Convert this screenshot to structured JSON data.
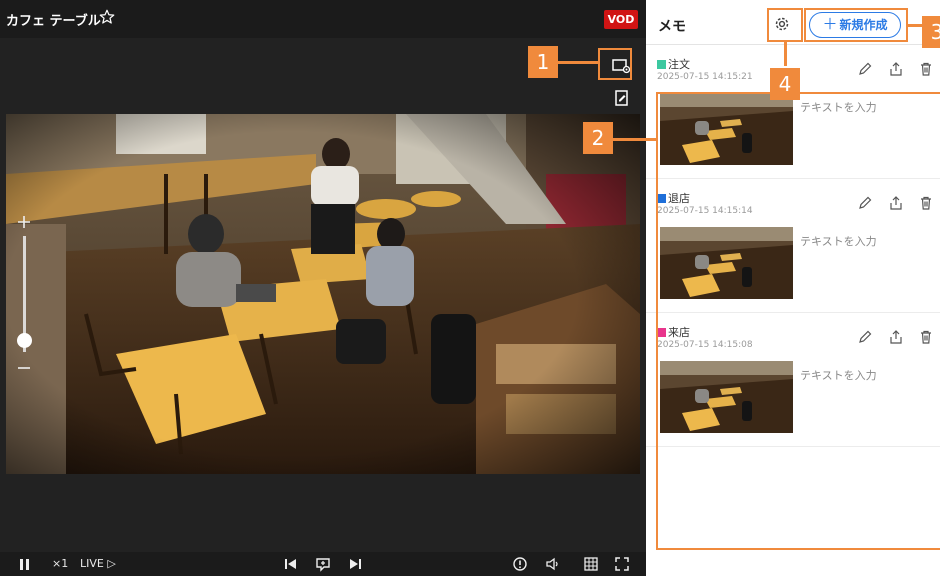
{
  "camera": {
    "title": "カフェ テーブル",
    "mode_badge": "VOD"
  },
  "zoom": {
    "level": 0.12
  },
  "controls": {
    "speed": "×1",
    "live": "LIVE ▷"
  },
  "memo": {
    "title": "メモ",
    "new_button": "新規作成",
    "items": [
      {
        "label": "注文",
        "time": "2025-07-15 14:15:21",
        "text": "テキストを入力",
        "color": "#3cc8a0"
      },
      {
        "label": "退店",
        "time": "2025-07-15 14:15:14",
        "text": "テキストを入力",
        "color": "#1e6fd9"
      },
      {
        "label": "来店",
        "time": "2025-07-15 14:15:08",
        "text": "テキストを入力",
        "color": "#e8358c"
      }
    ]
  },
  "callouts": [
    "1",
    "2",
    "3",
    "4"
  ],
  "colors": {
    "accent": "#2c7be5",
    "callout": "#f08a3c",
    "vod": "#d01414"
  }
}
